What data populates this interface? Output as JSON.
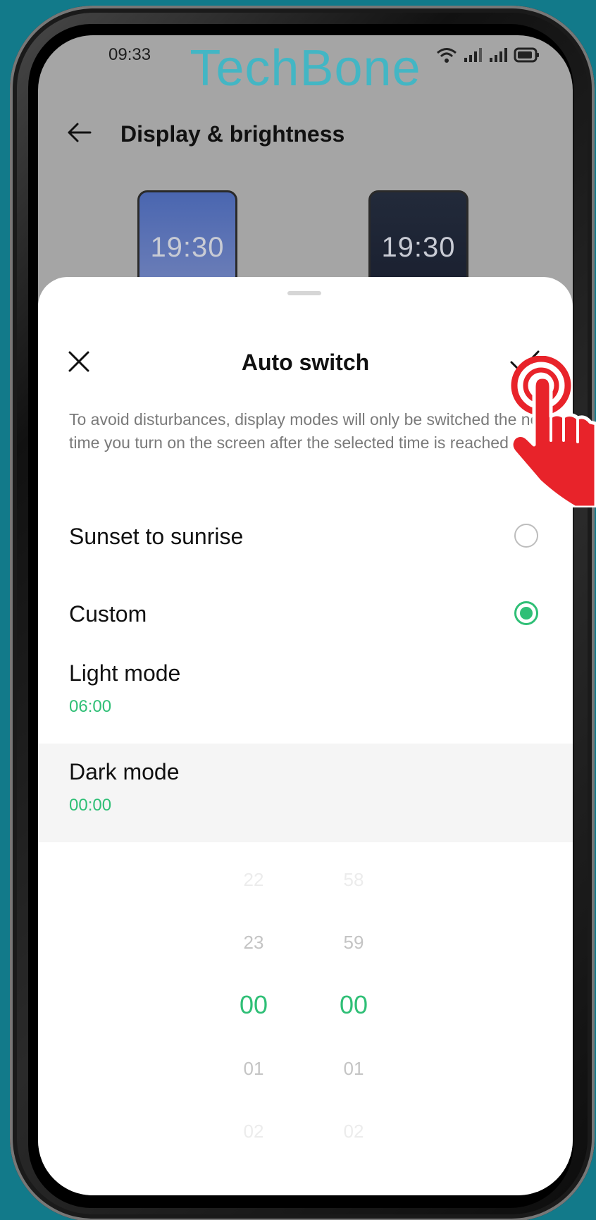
{
  "status_bar": {
    "time": "09:33"
  },
  "watermark": "TechBone",
  "header": {
    "title": "Display & brightness"
  },
  "previews": {
    "light_time": "19:30",
    "dark_time": "19:30"
  },
  "sheet": {
    "title": "Auto switch",
    "description": "To avoid disturbances, display modes will only be switched the next time you turn on the screen after the selected time is reached."
  },
  "options": [
    {
      "label": "Sunset to sunrise",
      "selected": false
    },
    {
      "label": "Custom",
      "selected": true
    }
  ],
  "light_mode": {
    "label": "Light mode",
    "value": "06:00"
  },
  "dark_mode": {
    "label": "Dark mode",
    "value": "00:00"
  },
  "picker": {
    "hours": [
      "22",
      "23",
      "00",
      "01",
      "02"
    ],
    "minutes": [
      "58",
      "59",
      "00",
      "01",
      "02"
    ]
  },
  "colors": {
    "accent": "#2fbf76",
    "background": "#127a8a",
    "hand": "#e8232a"
  }
}
